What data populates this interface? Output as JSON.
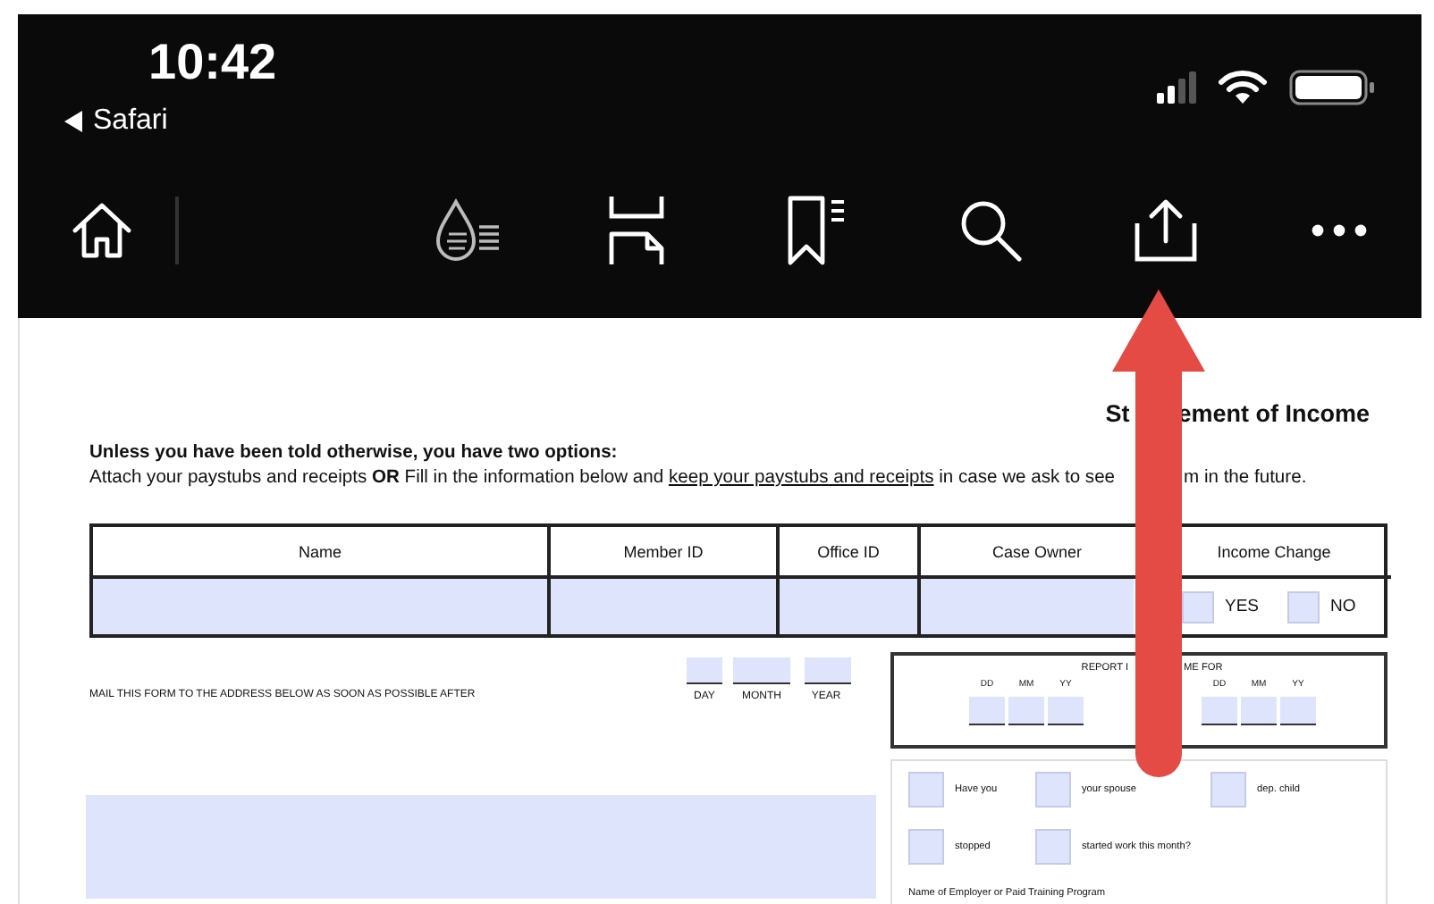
{
  "status_bar": {
    "time": "10:42",
    "back_label": "Safari"
  },
  "document": {
    "title_parts": [
      "St",
      "ement of Income"
    ],
    "intro_heading": "Unless you have been told otherwise, you have two options:",
    "intro_segments": [
      {
        "text": "Attach your paystubs and receipts ",
        "kind": "plain"
      },
      {
        "text": "OR",
        "kind": "bold"
      },
      {
        "text": " Fill in the information below and ",
        "kind": "plain"
      },
      {
        "text": "keep your paystubs and receipts",
        "kind": "underline"
      },
      {
        "text": " in case we ask to see",
        "kind": "plain"
      }
    ],
    "intro_continuation": "m in the future.",
    "table": {
      "columns": [
        {
          "label": "Name",
          "kind": "field"
        },
        {
          "label": "Member ID",
          "kind": "field"
        },
        {
          "label": "Office ID",
          "kind": "field"
        },
        {
          "label": "Case Owner",
          "kind": "field"
        },
        {
          "label": "Income Change",
          "kind": "choice"
        }
      ],
      "choices": [
        {
          "label": "YES",
          "checked": false
        },
        {
          "label": "NO",
          "checked": false
        }
      ]
    },
    "mail_note": "MAIL THIS FORM TO THE ADDRESS BELOW AS SOON AS POSSIBLE AFTER",
    "date_fields": [
      "DAY",
      "MONTH",
      "YEAR"
    ],
    "report": {
      "title_parts": [
        "REPORT I",
        "ME FOR"
      ],
      "from_labels": [
        "DD",
        "MM",
        "YY"
      ],
      "to_labels": [
        "DD",
        "MM",
        "YY"
      ]
    },
    "status_checks": [
      {
        "label": "Have you",
        "checked": false
      },
      {
        "label": "your spouse",
        "checked": false
      },
      {
        "label": "dep. child",
        "checked": false
      },
      {
        "label": "stopped",
        "checked": false
      },
      {
        "label": "started work this month?",
        "checked": false
      }
    ],
    "employer_label": "Name of Employer or Paid Training Program"
  }
}
